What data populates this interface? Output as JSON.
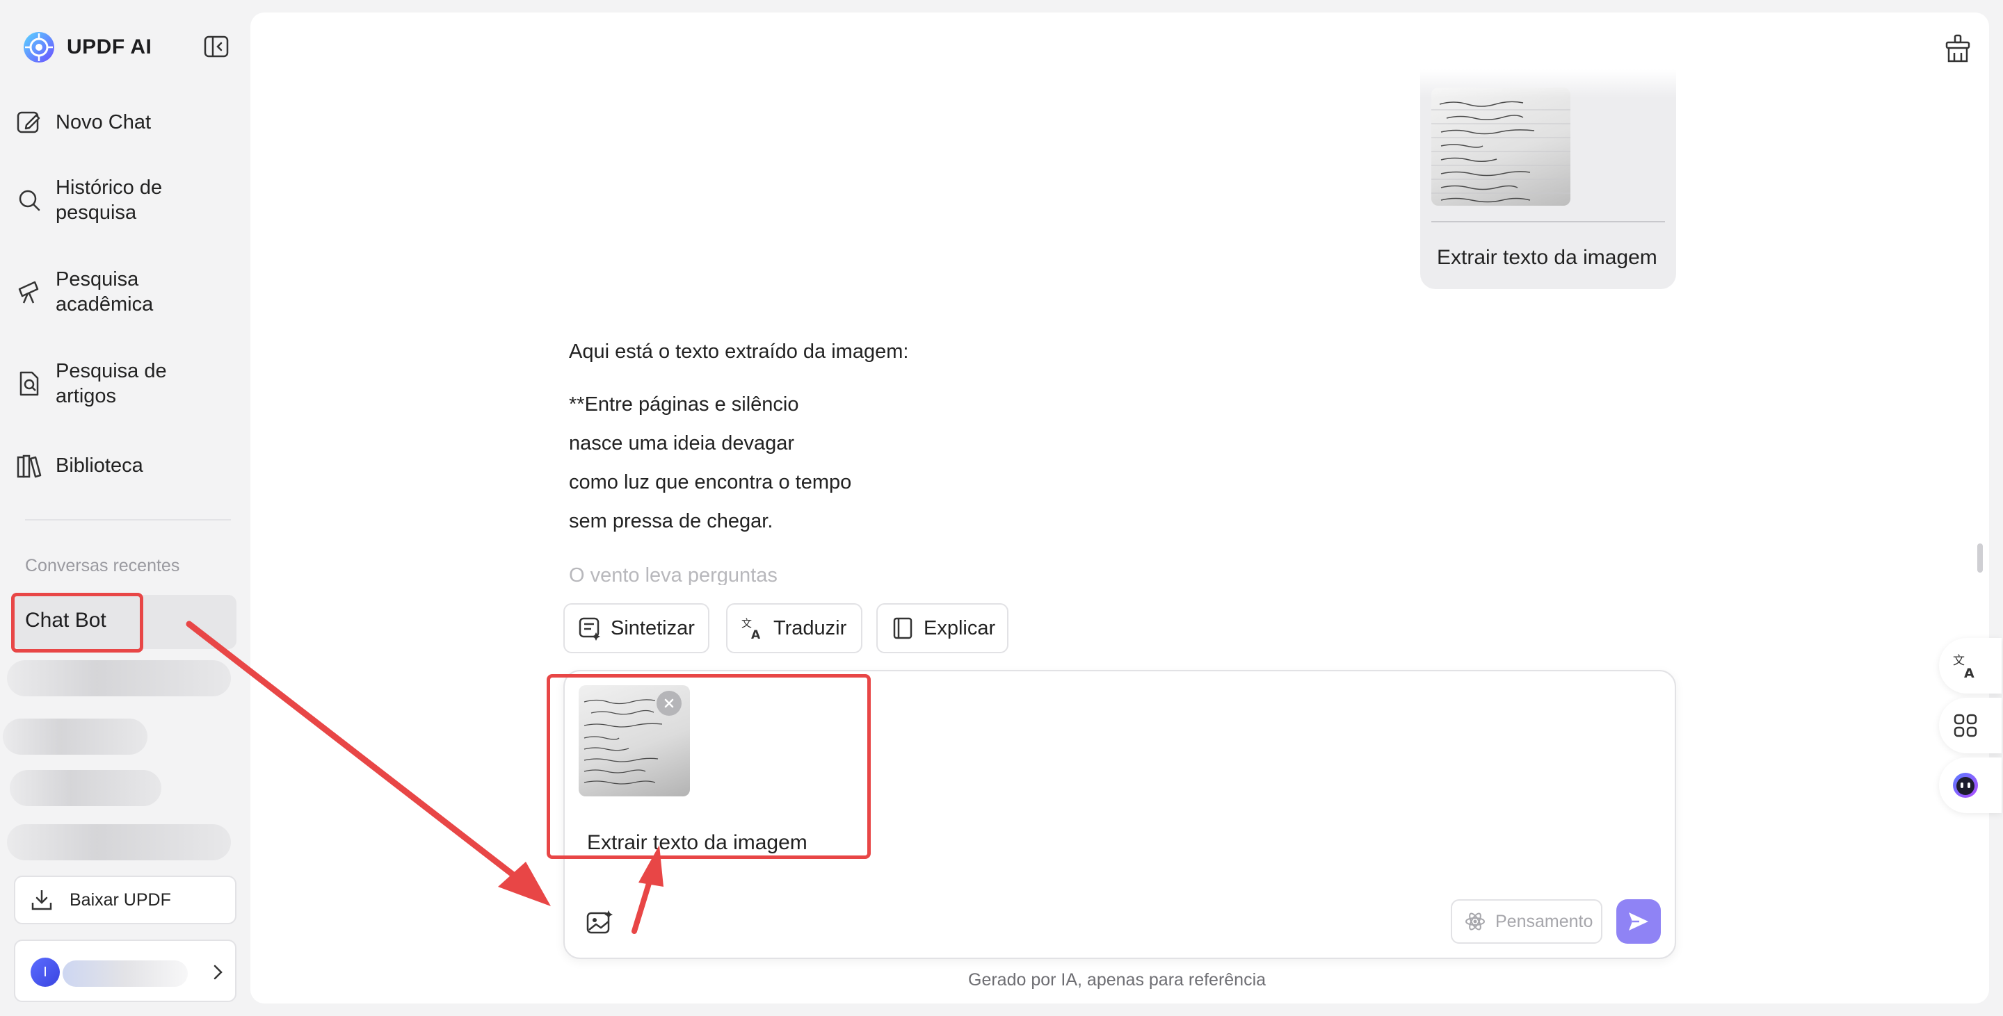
{
  "brand": {
    "name": "UPDF AI"
  },
  "nav": [
    {
      "lines": [
        "Novo Chat"
      ],
      "icon": "edit-icon"
    },
    {
      "lines": [
        "Histórico de",
        "pesquisa"
      ],
      "icon": "search-icon"
    },
    {
      "lines": [
        "Pesquisa",
        "acadêmica"
      ],
      "icon": "telescope-icon"
    },
    {
      "lines": [
        "Pesquisa de",
        "artigos"
      ],
      "icon": "doc-search-icon"
    },
    {
      "lines": [
        "Biblioteca"
      ],
      "icon": "library-icon"
    }
  ],
  "recent": {
    "label": "Conversas recentes",
    "active_chat": "Chat Bot"
  },
  "download": {
    "label": "Baixar UPDF"
  },
  "account": {
    "avatar_initial": "I"
  },
  "user_message": {
    "text": "Extrair texto da imagem"
  },
  "reply": {
    "intro": "Aqui está o texto extraído da imagem:",
    "lines": [
      "**Entre páginas e silêncio",
      "nasce uma ideia devagar",
      "como luz que encontra o tempo",
      "sem pressa de chegar.",
      "O vento leva perguntas"
    ]
  },
  "actions": [
    {
      "label": "Sintetizar",
      "icon": "summarize-icon"
    },
    {
      "label": "Traduzir",
      "icon": "translate-icon"
    },
    {
      "label": "Explicar",
      "icon": "book-icon"
    }
  ],
  "composer": {
    "text": "Extrair texto da imagem",
    "think_label": "Pensamento"
  },
  "footer": {
    "note": "Gerado por IA, apenas para referência"
  },
  "colors": {
    "accent": "#8f83f5",
    "highlight": "#e84646",
    "sidebar_bg": "#f3f3f4"
  }
}
